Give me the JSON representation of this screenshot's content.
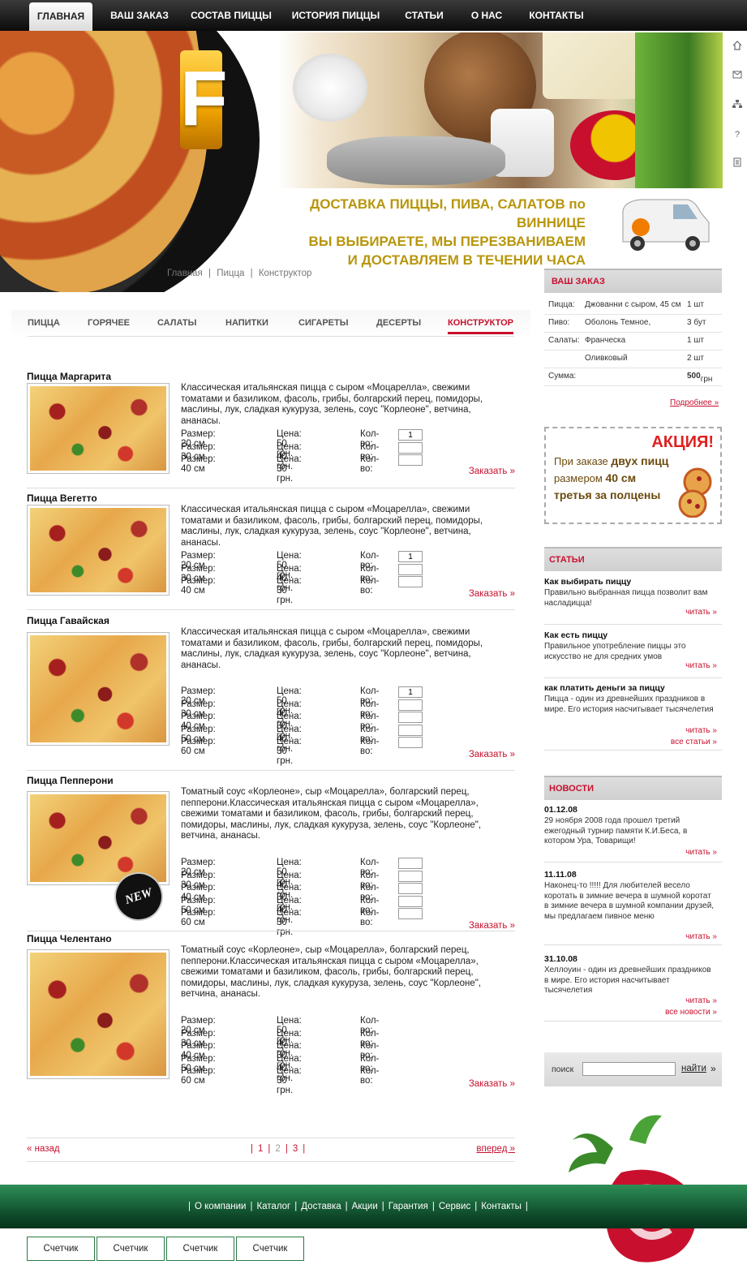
{
  "nav": {
    "items": [
      "ГЛАВНАЯ",
      "ВАШ ЗАКАЗ",
      "СОСТАВ ПИЦЦЫ",
      "ИСТОРИЯ ПИЦЦЫ",
      "СТАТЬИ",
      "О НАС",
      "КОНТАКТЫ"
    ],
    "active": "ГЛАВНАЯ"
  },
  "side_icons": [
    "home-icon",
    "mail-icon",
    "sitemap-icon",
    "help-icon",
    "print-icon"
  ],
  "logo": {
    "letter": "F"
  },
  "promo": {
    "line1": "ДОСТАВКА ПИЦЦЫ, ПИВА, САЛАТОВ по ВИННИЦЕ",
    "line2": "ВЫ ВЫБИРАЕТЕ, МЫ ПЕРЕЗВАНИВАЕМ",
    "line3": "И ДОСТАВЛЯЕМ В ТЕЧЕНИИ ЧАСА"
  },
  "breadcrumb": [
    "Главная",
    "Пицца",
    "Конструктор"
  ],
  "categories": [
    "ПИЦЦА",
    "ГОРЯЧЕЕ",
    "САЛАТЫ",
    "НАПИТКИ",
    "СИГАРЕТЫ",
    "ДЕСЕРТЫ",
    "КОНСТРУКТОР"
  ],
  "active_category": "КОНСТРУКТОР",
  "labels": {
    "size": "Размер:",
    "price": "Цена:",
    "qty": "Кол-во:",
    "order": "Заказать »"
  },
  "products": [
    {
      "name": "Пицца Маргарита",
      "desc": "Классическая итальянская пицца с сыром «Моцарелла», свежими томатами и базиликом, фасоль, грибы, болгарский перец, помидоры, маслины, лук, сладкая кукуруза, зелень, соус \"Корлеоне\", ветчина, ананасы.",
      "rows": [
        {
          "size": "20 см",
          "price": "50 грн.",
          "qty": "1"
        },
        {
          "size": "30 см",
          "price": "40 грн.",
          "qty": ""
        },
        {
          "size": "40 см",
          "price": "30 грн.",
          "qty": ""
        }
      ]
    },
    {
      "name": "Пицца Вегетто",
      "desc": "Классическая итальянская пицца с сыром «Моцарелла», свежими томатами и базиликом, фасоль, грибы, болгарский перец, помидоры, маслины, лук, сладкая кукуруза, зелень, соус \"Корлеоне\", ветчина, ананасы.",
      "rows": [
        {
          "size": "20 см",
          "price": "50 грн.",
          "qty": "1"
        },
        {
          "size": "30 см",
          "price": "40 грн.",
          "qty": ""
        },
        {
          "size": "40 см",
          "price": "30 грн.",
          "qty": ""
        }
      ]
    },
    {
      "name": "Пицца Гавайская",
      "desc": "Классическая итальянская пицца с сыром «Моцарелла», свежими томатами и базиликом, фасоль, грибы, болгарский перец, помидоры, маслины, лук, сладкая кукуруза, зелень, соус \"Корлеоне\", ветчина, ананасы.",
      "rows": [
        {
          "size": "20 см",
          "price": "50 грн.",
          "qty": "1"
        },
        {
          "size": "30 см",
          "price": "40 грн.",
          "qty": ""
        },
        {
          "size": "40 см",
          "price": "30 грн.",
          "qty": ""
        },
        {
          "size": "50 см",
          "price": "40 грн.",
          "qty": ""
        },
        {
          "size": "60 см",
          "price": "30 грн.",
          "qty": ""
        }
      ]
    },
    {
      "name": "Пицца Пепперони",
      "desc": "Томатный соус «Корлеоне», сыр «Моцарелла», болгарский перец, пепперони.Классическая итальянская пицца с сыром «Моцарелла», свежими томатами и базиликом, фасоль, грибы, болгарский перец, помидоры, маслины, лук, сладкая кукуруза, зелень, соус \"Корлеоне\", ветчина, ананасы.",
      "badge": "NEW",
      "rows": [
        {
          "size": "20 см",
          "price": "50 грн.",
          "qty": ""
        },
        {
          "size": "30 см",
          "price": "40 грн.",
          "qty": ""
        },
        {
          "size": "40 см",
          "price": "30 грн.",
          "qty": ""
        },
        {
          "size": "50 см",
          "price": "40 грн.",
          "qty": ""
        },
        {
          "size": "60 см",
          "price": "30 грн.",
          "qty": ""
        }
      ]
    },
    {
      "name": "Пицца Челентано",
      "desc": "Томатный соус «Корлеоне», сыр «Моцарелла», болгарский перец, пепперони.Классическая итальянская пицца с сыром «Моцарелла», свежими томатами и базиликом, фасоль, грибы, болгарский перец, помидоры, маслины, лук, сладкая кукуруза, зелень, соус \"Корлеоне\", ветчина, ананасы.",
      "rows": [
        {
          "size": "20 см",
          "price": "50 грн."
        },
        {
          "size": "30 см",
          "price": "40 грн."
        },
        {
          "size": "40 см",
          "price": "30 грн."
        },
        {
          "size": "50 см",
          "price": "40 грн."
        },
        {
          "size": "60 см",
          "price": "30 грн."
        }
      ]
    }
  ],
  "pager": {
    "back": "« назад",
    "forward": "вперед »",
    "pages": [
      "1",
      "2",
      "3"
    ],
    "current": "2"
  },
  "cart": {
    "title": "ВАШ ЗАКАЗ",
    "rows": [
      {
        "cat": "Пицца:",
        "item": "Джованни с сыром, 45 см",
        "qty": "1 шт"
      },
      {
        "cat": "Пиво:",
        "item": "Оболонь Темное,",
        "qty": "3 бут"
      },
      {
        "cat": "Салаты:",
        "item": "Франческа",
        "qty": "1 шт"
      },
      {
        "cat": "",
        "item": "Оливковый",
        "qty": "2 шт"
      }
    ],
    "sum_label": "Сумма:",
    "sum_value": "500",
    "sum_unit": "грн",
    "more": "Подробнее »"
  },
  "akcia": {
    "title": "АКЦИЯ!",
    "l1a": "При заказе ",
    "l1b": "двух пицц",
    "l2a": "размером ",
    "l2b": "40 см",
    "l3": "третья за полцены"
  },
  "articles": {
    "title": "СТАТЬИ",
    "items": [
      {
        "title": "Как выбирать пиццу",
        "text": "Правильно выбранная пицца позволит вам насладицца!"
      },
      {
        "title": "Как есть пиццу",
        "text": "Правильное употребление пиццы это искусство не для средних умов"
      },
      {
        "title": "как платить деньги за пиццу",
        "text": "Пицца - один из древнейших праздников в мире. Его история насчитывает тысячелетия"
      }
    ],
    "read": "читать »",
    "all": "все статьи »"
  },
  "news": {
    "title": "НОВОСТИ",
    "items": [
      {
        "date": "01.12.08",
        "text": "29 ноября 2008 года прошел третий ежегодный турнир памяти К.И.Беса, в котором Ура, Товарищи!"
      },
      {
        "date": "11.11.08",
        "text": "Наконец-то !!!!! Для любителей весело коротать в зимние вечера в шумной коротат в зимние вечера в шумной компании друзей, мы предлагаем пивное меню"
      },
      {
        "date": "31.10.08",
        "text": "Хеллоуин - один из древнейших праздников в мире. Его история насчитывает тысячелетия"
      }
    ],
    "read": "читать »",
    "all": "все новости »"
  },
  "search": {
    "label": "поиск",
    "button": "найти",
    "placeholder": ""
  },
  "footer": {
    "links": [
      "О компании",
      "Каталог",
      "Доставка",
      "Акции",
      "Гарантия",
      "Сервис",
      "Контакты"
    ],
    "counters": [
      "Счетчик",
      "Счетчик",
      "Счетчик",
      "Счетчик"
    ]
  },
  "colors": {
    "accent": "#c8102e",
    "nav_bg": "#111111",
    "promo_text": "#b8960c",
    "footer": "#1f6b3d"
  }
}
